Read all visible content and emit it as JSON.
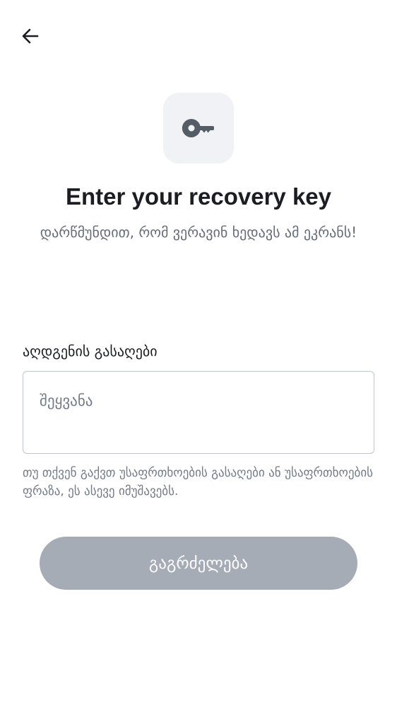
{
  "header": {
    "back_icon": "arrow-left-icon"
  },
  "hero": {
    "icon": "key-icon",
    "icon_color": "#555c66",
    "tile_color": "#f0f2f5",
    "title": "Enter your recovery key",
    "subtitle": "დარწმუნდით, რომ ვერავინ ხედავს ამ ეკრანს!"
  },
  "form": {
    "label": "აღდგენის გასაღები",
    "placeholder": "შეყვანა",
    "value": "",
    "helper": "თუ თქვენ გაქვთ უსაფრთხოების გასაღები ან უსაფრთხოების ფრაზა, ეს ასევე იმუშავებს."
  },
  "actions": {
    "continue_label": "გაგრძელება",
    "continue_enabled": false,
    "continue_color": "#a6acb5"
  }
}
